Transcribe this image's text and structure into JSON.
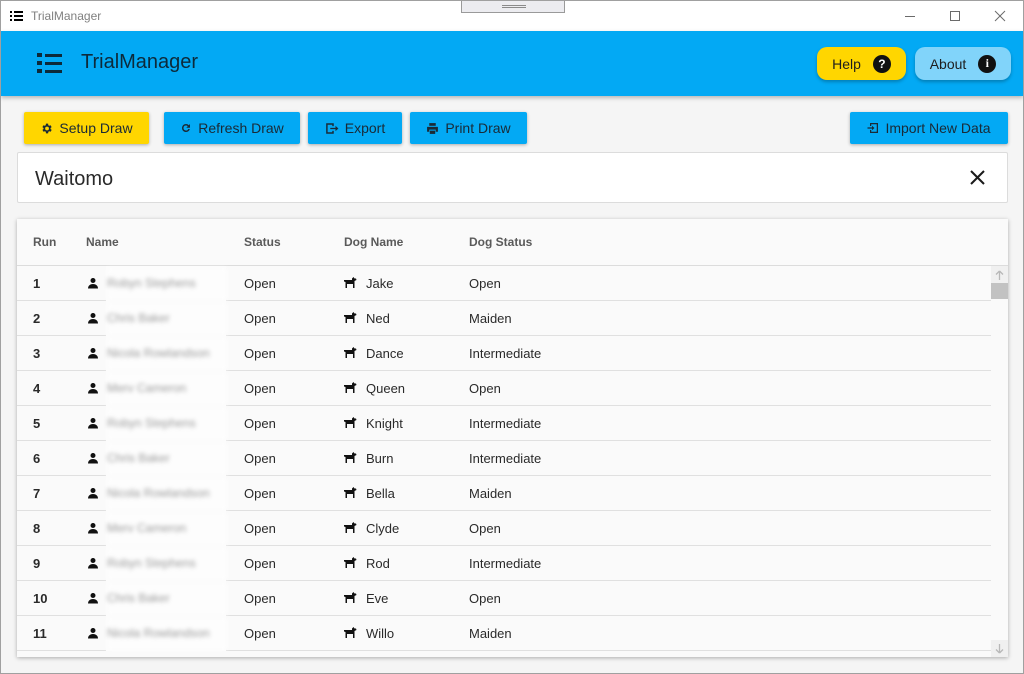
{
  "window": {
    "title": "TrialManager",
    "controls": [
      "minimize",
      "maximize",
      "close"
    ]
  },
  "appbar": {
    "title": "TrialManager",
    "help_label": "Help",
    "help_icon": "?",
    "about_label": "About",
    "about_icon": "i"
  },
  "toolbar": {
    "setup_draw": "Setup Draw",
    "refresh_draw": "Refresh Draw",
    "export": "Export",
    "print_draw": "Print Draw",
    "import_new_data": "Import New Data"
  },
  "venue": {
    "name": "Waitomo"
  },
  "table": {
    "columns": [
      "Run",
      "Name",
      "Status",
      "Dog Name",
      "Dog Status"
    ],
    "rows": [
      {
        "run": "1",
        "name": "Robyn Stephens",
        "status": "Open",
        "dog_name": "Jake",
        "dog_status": "Open"
      },
      {
        "run": "2",
        "name": "Chris Baker",
        "status": "Open",
        "dog_name": "Ned",
        "dog_status": "Maiden"
      },
      {
        "run": "3",
        "name": "Nicola Rowlandson",
        "status": "Open",
        "dog_name": "Dance",
        "dog_status": "Intermediate"
      },
      {
        "run": "4",
        "name": "Merv Cameron",
        "status": "Open",
        "dog_name": "Queen",
        "dog_status": "Open"
      },
      {
        "run": "5",
        "name": "Robyn Stephens",
        "status": "Open",
        "dog_name": "Knight",
        "dog_status": "Intermediate"
      },
      {
        "run": "6",
        "name": "Chris Baker",
        "status": "Open",
        "dog_name": "Burn",
        "dog_status": "Intermediate"
      },
      {
        "run": "7",
        "name": "Nicola Rowlandson",
        "status": "Open",
        "dog_name": "Bella",
        "dog_status": "Maiden"
      },
      {
        "run": "8",
        "name": "Merv Cameron",
        "status": "Open",
        "dog_name": "Clyde",
        "dog_status": "Open"
      },
      {
        "run": "9",
        "name": "Robyn Stephens",
        "status": "Open",
        "dog_name": "Rod",
        "dog_status": "Intermediate"
      },
      {
        "run": "10",
        "name": "Chris Baker",
        "status": "Open",
        "dog_name": "Eve",
        "dog_status": "Open"
      },
      {
        "run": "11",
        "name": "Nicola Rowlandson",
        "status": "Open",
        "dog_name": "Willo",
        "dog_status": "Maiden"
      }
    ]
  },
  "colors": {
    "appbar": "#03a9f4",
    "yellow_accent": "#ffd600",
    "light_blue": "#81d4fa"
  }
}
